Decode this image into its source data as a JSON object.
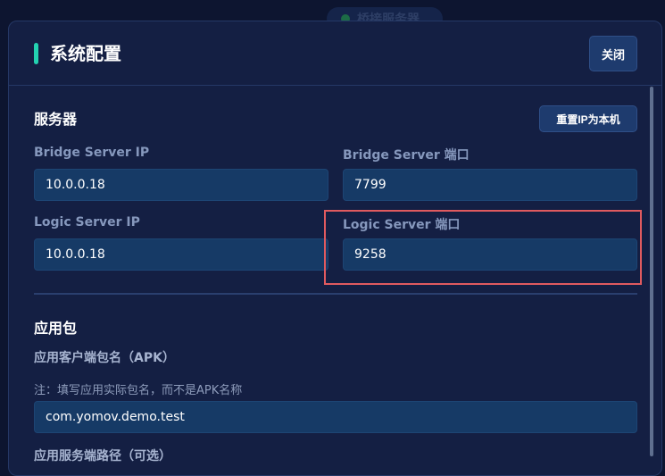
{
  "backdrop": {
    "status_text": "桥接服务器"
  },
  "modal": {
    "title": "系统配置",
    "close_label": "关闭"
  },
  "server_section": {
    "title": "服务器",
    "reset_label": "重置IP为本机",
    "bridge_ip_label": "Bridge Server IP",
    "bridge_ip_value": "10.0.0.18",
    "bridge_port_label": "Bridge Server 端口",
    "bridge_port_value": "7799",
    "logic_ip_label": "Logic Server IP",
    "logic_ip_value": "10.0.0.18",
    "logic_port_label": "Logic Server 端口",
    "logic_port_value": "9258"
  },
  "app_section": {
    "title": "应用包",
    "package_label": "应用客户端包名（APK）",
    "package_hint": "注：填写应用实际包名，而不是APK名称",
    "package_value": "com.yomov.demo.test",
    "server_path_label": "应用服务端路径（可选）"
  },
  "colors": {
    "accent": "#23d2b1",
    "highlight": "#e05a5f",
    "status_dot": "#1c6b46"
  }
}
